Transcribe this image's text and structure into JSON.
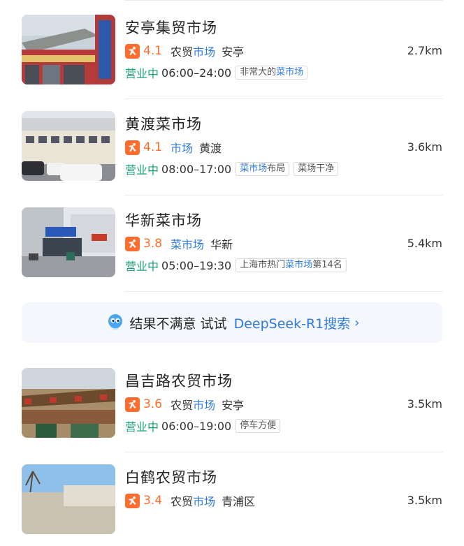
{
  "results": [
    {
      "name": "安亭集贸市场",
      "rating": "4.1",
      "category_pre": "农贸",
      "category_hl": "市场",
      "area": "安亭",
      "distance": "2.7km",
      "status": "营业中",
      "hours": "06:00–24:00",
      "tag": {
        "pre": "非常大的",
        "hl": "菜市场",
        "post": ""
      }
    },
    {
      "name": "黄渡菜市场",
      "rating": "4.1",
      "category_pre": "",
      "category_hl": "市场",
      "area": "黄渡",
      "distance": "3.6km",
      "status": "营业中",
      "hours": "08:00–17:00",
      "tag": {
        "pre": "",
        "hl": "菜市场",
        "post": "布局"
      },
      "tag2": {
        "text": "菜场干净"
      }
    },
    {
      "name": "华新菜市场",
      "rating": "3.8",
      "category_pre": "",
      "category_hl": "菜市场",
      "area": "华新",
      "distance": "5.4km",
      "status": "营业中",
      "hours": "05:00–19:30",
      "tag": {
        "pre": "上海市热门",
        "hl": "菜市场",
        "post": "第14名"
      }
    },
    {
      "name": "昌吉路农贸市场",
      "rating": "3.6",
      "category_pre": "农贸",
      "category_hl": "市场",
      "area": "安亭",
      "distance": "3.5km",
      "status": "营业中",
      "hours": "06:00–19:00",
      "tag": {
        "pre": "停车方便",
        "hl": "",
        "post": ""
      }
    },
    {
      "name": "白鹤农贸市场",
      "rating": "3.4",
      "category_pre": "农贸",
      "category_hl": "市场",
      "area": "青浦区",
      "distance": "3.5km"
    }
  ],
  "ai_banner": {
    "text": "结果不满意 试试",
    "link": "DeepSeek-R1搜索",
    "chevron": "›",
    "icon": "ai-assistant-icon"
  },
  "colors": {
    "rating_orange": "#ff6d2e",
    "highlight_blue": "#2f7bd9",
    "open_green": "#1aa37a"
  }
}
